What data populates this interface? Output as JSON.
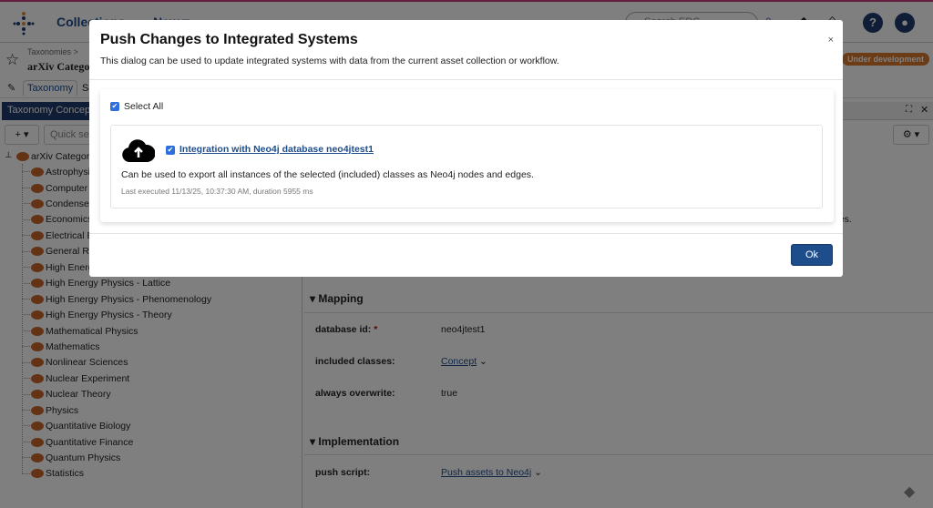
{
  "topbar": {
    "nav_collections": "Collections",
    "nav_new": "New ▾",
    "search_placeholder": "Search EDG",
    "help": "?",
    "count": "0"
  },
  "asset": {
    "breadcrumb": "Taxonomies >",
    "title": "arXiv Categories",
    "status": "Under development",
    "tab_label": "Taxonomy",
    "tab_partial": "Se"
  },
  "left_panel": {
    "header": "Taxonomy Concepts",
    "add_label": "+ ▾",
    "quick_search": "Quick search",
    "root": "arXiv Categories",
    "items": [
      "Astrophysics",
      "Computer Science",
      "Condensed Matter",
      "Economics",
      "Electrical Engineering",
      "General Relativity",
      "High Energy Physics - Experiment",
      "High Energy Physics - Lattice",
      "High Energy Physics - Phenomenology",
      "High Energy Physics - Theory",
      "Mathematical Physics",
      "Mathematics",
      "Nonlinear Sciences",
      "Nuclear Experiment",
      "Nuclear Theory",
      "Physics",
      "Quantitative Biology",
      "Quantitative Finance",
      "Quantum Physics",
      "Statistics"
    ]
  },
  "right_panel": {
    "partial_text": "ges.",
    "mapping": {
      "title": "Mapping",
      "fields": [
        {
          "label": "database id:",
          "required": "*",
          "value": "neo4jtest1"
        },
        {
          "label": "included classes:",
          "value": "Concept"
        },
        {
          "label": "always overwrite:",
          "value": "true"
        }
      ]
    },
    "implementation": {
      "title": "Implementation",
      "fields": [
        {
          "label": "push script:",
          "value": "Push assets to Neo4j"
        }
      ]
    }
  },
  "modal": {
    "title": "Push Changes to Integrated Systems",
    "subtitle": "This dialog can be used to update integrated systems with data from the current asset collection or workflow.",
    "close": "×",
    "select_all": "Select All",
    "integration": {
      "name": "Integration with Neo4j database neo4jtest1",
      "description": "Can be used to export all instances of the selected (included) classes as Neo4j nodes and edges.",
      "last_executed": "Last executed 11/13/25, 10:37:30 AM, duration 5955 ms",
      "checked": true
    },
    "ok_label": "Ok"
  }
}
